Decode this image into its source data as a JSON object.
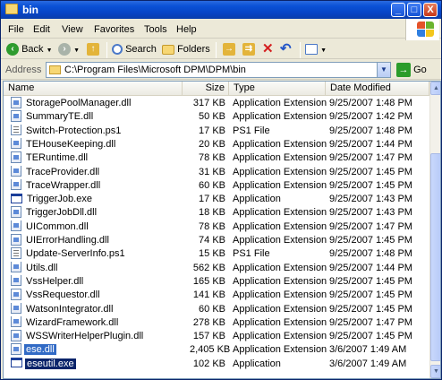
{
  "window": {
    "title": "bin",
    "controls": {
      "minimize": "_",
      "maximize": "□",
      "close": "X"
    }
  },
  "menu": [
    "File",
    "Edit",
    "View",
    "Favorites",
    "Tools",
    "Help"
  ],
  "toolbar": {
    "back": "Back",
    "search": "Search",
    "folders": "Folders"
  },
  "address": {
    "label": "Address",
    "value": "C:\\Program Files\\Microsoft DPM\\DPM\\bin",
    "go": "Go"
  },
  "columns": [
    "Name",
    "Size",
    "Type",
    "Date Modified"
  ],
  "files": [
    {
      "name": "StoragePoolManager.dll",
      "size": "317 KB",
      "type": "Application Extension",
      "date": "9/25/2007 1:48 PM",
      "icon": "dll"
    },
    {
      "name": "SummaryTE.dll",
      "size": "50 KB",
      "type": "Application Extension",
      "date": "9/25/2007 1:42 PM",
      "icon": "dll"
    },
    {
      "name": "Switch-Protection.ps1",
      "size": "17 KB",
      "type": "PS1 File",
      "date": "9/25/2007 1:48 PM",
      "icon": "ps1"
    },
    {
      "name": "TEHouseKeeping.dll",
      "size": "20 KB",
      "type": "Application Extension",
      "date": "9/25/2007 1:44 PM",
      "icon": "dll"
    },
    {
      "name": "TERuntime.dll",
      "size": "78 KB",
      "type": "Application Extension",
      "date": "9/25/2007 1:47 PM",
      "icon": "dll"
    },
    {
      "name": "TraceProvider.dll",
      "size": "31 KB",
      "type": "Application Extension",
      "date": "9/25/2007 1:45 PM",
      "icon": "dll"
    },
    {
      "name": "TraceWrapper.dll",
      "size": "60 KB",
      "type": "Application Extension",
      "date": "9/25/2007 1:45 PM",
      "icon": "dll"
    },
    {
      "name": "TriggerJob.exe",
      "size": "17 KB",
      "type": "Application",
      "date": "9/25/2007 1:43 PM",
      "icon": "exe"
    },
    {
      "name": "TriggerJobDll.dll",
      "size": "18 KB",
      "type": "Application Extension",
      "date": "9/25/2007 1:43 PM",
      "icon": "dll"
    },
    {
      "name": "UICommon.dll",
      "size": "78 KB",
      "type": "Application Extension",
      "date": "9/25/2007 1:47 PM",
      "icon": "dll"
    },
    {
      "name": "UIErrorHandling.dll",
      "size": "74 KB",
      "type": "Application Extension",
      "date": "9/25/2007 1:45 PM",
      "icon": "dll"
    },
    {
      "name": "Update-ServerInfo.ps1",
      "size": "15 KB",
      "type": "PS1 File",
      "date": "9/25/2007 1:48 PM",
      "icon": "ps1"
    },
    {
      "name": "Utils.dll",
      "size": "562 KB",
      "type": "Application Extension",
      "date": "9/25/2007 1:44 PM",
      "icon": "dll"
    },
    {
      "name": "VssHelper.dll",
      "size": "165 KB",
      "type": "Application Extension",
      "date": "9/25/2007 1:45 PM",
      "icon": "dll"
    },
    {
      "name": "VssRequestor.dll",
      "size": "141 KB",
      "type": "Application Extension",
      "date": "9/25/2007 1:45 PM",
      "icon": "dll"
    },
    {
      "name": "WatsonIntegrator.dll",
      "size": "60 KB",
      "type": "Application Extension",
      "date": "9/25/2007 1:45 PM",
      "icon": "dll"
    },
    {
      "name": "WizardFramework.dll",
      "size": "278 KB",
      "type": "Application Extension",
      "date": "9/25/2007 1:47 PM",
      "icon": "dll"
    },
    {
      "name": "WSSWriterHelperPlugin.dll",
      "size": "157 KB",
      "type": "Application Extension",
      "date": "9/25/2007 1:45 PM",
      "icon": "dll"
    },
    {
      "name": "ese.dll",
      "size": "2,405 KB",
      "type": "Application Extension",
      "date": "3/6/2007 1:49 AM",
      "icon": "dll",
      "selected": true
    },
    {
      "name": "eseutil.exe",
      "size": "102 KB",
      "type": "Application",
      "date": "3/6/2007 1:49 AM",
      "icon": "exe",
      "selected": true
    }
  ]
}
